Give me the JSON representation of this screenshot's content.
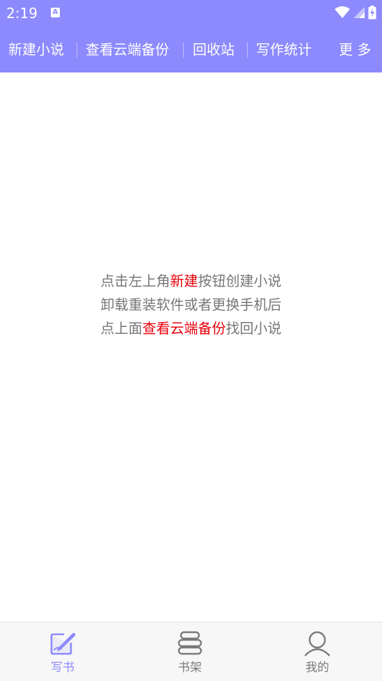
{
  "status_bar": {
    "time": "2:19",
    "notification_icon": "A"
  },
  "toolbar": {
    "items": [
      "新建小说",
      "查看云端备份",
      "回收站",
      "写作统计",
      "更 多"
    ]
  },
  "empty_message": {
    "line1_pre": "点击左上角",
    "line1_highlight": "新建",
    "line1_post": "按钮创建小说",
    "line2": "卸载重装软件或者更换手机后",
    "line3_pre": "点上面",
    "line3_highlight": "查看云端备份",
    "line3_post": "找回小说",
    "highlight_color": "#e8000b"
  },
  "bottom_nav": {
    "items": [
      {
        "label": "写书",
        "icon": "pen-book-icon",
        "active": true
      },
      {
        "label": "书架",
        "icon": "bookshelf-icon",
        "active": false
      },
      {
        "label": "我的",
        "icon": "profile-icon",
        "active": false
      }
    ]
  },
  "colors": {
    "accent": "#8c8afc",
    "inactive": "#7a7a7a"
  }
}
